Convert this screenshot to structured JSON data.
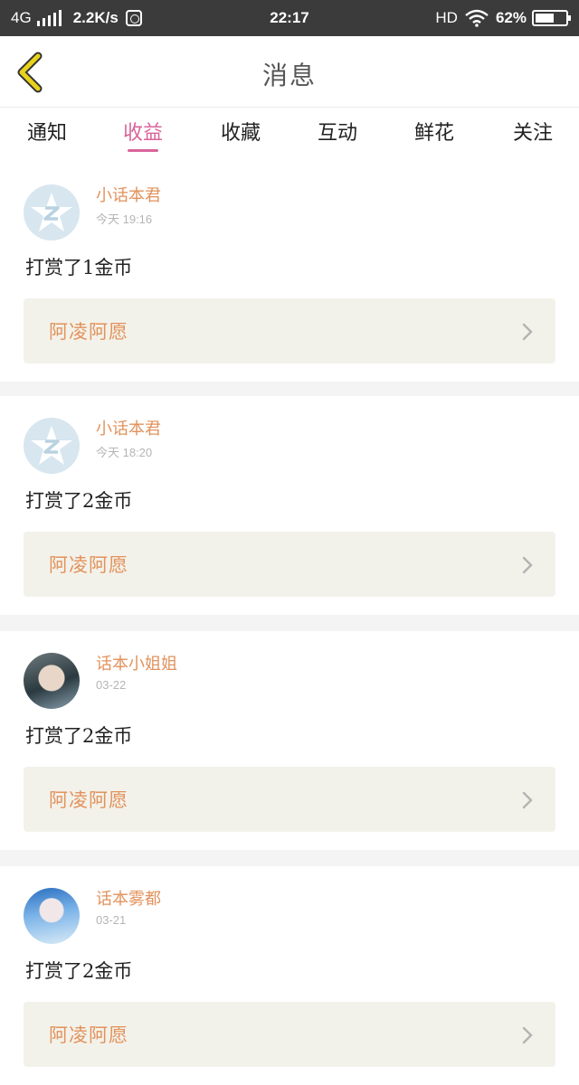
{
  "status_bar": {
    "network": "4G",
    "speed": "2.2K/s",
    "time": "22:17",
    "hd": "HD",
    "battery": "62%",
    "battery_level": 0.62
  },
  "header": {
    "title": "消息",
    "back_icon": "chevron-left-icon",
    "accent_color": "#e8d21c"
  },
  "tabs": [
    {
      "label": "通知",
      "active": false
    },
    {
      "label": "收益",
      "active": true
    },
    {
      "label": "收藏",
      "active": false
    },
    {
      "label": "互动",
      "active": false
    },
    {
      "label": "鲜花",
      "active": false
    },
    {
      "label": "关注",
      "active": false
    }
  ],
  "colors": {
    "active_tab": "#d9649b",
    "username": "#e2925c",
    "book_bg": "#f3f2ea"
  },
  "messages": [
    {
      "avatar": "qq-default-avatar",
      "username": "小话本君",
      "time": "今天 19:16",
      "text": "打赏了1金币",
      "book": "阿凌阿愿"
    },
    {
      "avatar": "qq-default-avatar",
      "username": "小话本君",
      "time": "今天 18:20",
      "text": "打赏了2金币",
      "book": "阿凌阿愿"
    },
    {
      "avatar": "user-photo-avatar",
      "username": "话本小姐姐",
      "time": "03-22",
      "text": "打赏了2金币",
      "book": "阿凌阿愿"
    },
    {
      "avatar": "user-photo-avatar",
      "username": "话本雾都",
      "time": "03-21",
      "text": "打赏了2金币",
      "book": "阿凌阿愿"
    }
  ]
}
